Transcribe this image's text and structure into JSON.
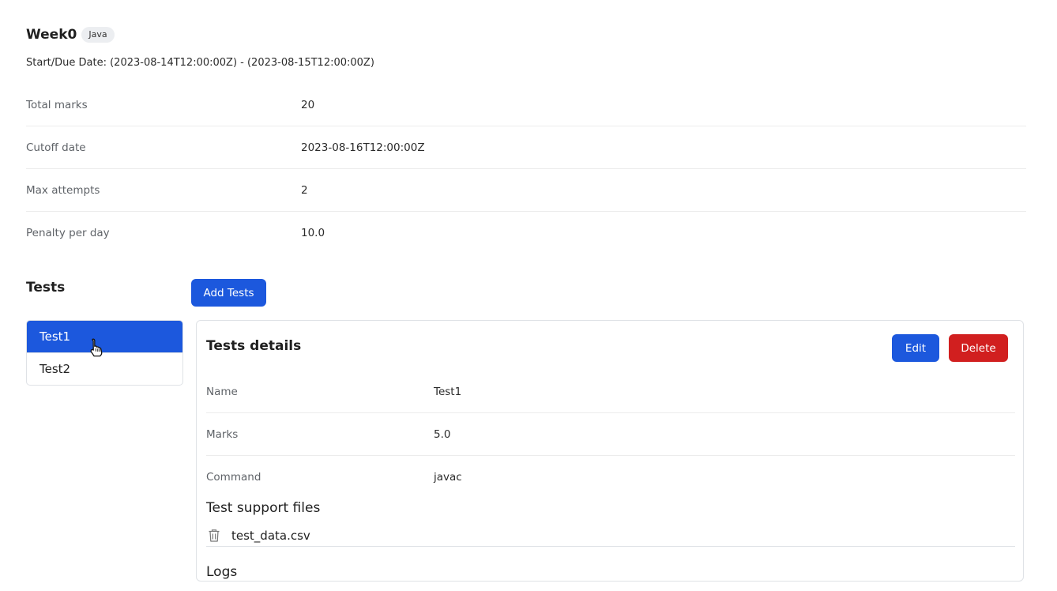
{
  "assignment": {
    "title": "Week0",
    "language": "Java",
    "dates": "Start/Due Date: (2023-08-14T12:00:00Z) - (2023-08-15T12:00:00Z)",
    "fields": [
      {
        "label": "Total marks",
        "value": "20"
      },
      {
        "label": "Cutoff date",
        "value": "2023-08-16T12:00:00Z"
      },
      {
        "label": "Max attempts",
        "value": "2"
      },
      {
        "label": "Penalty per day",
        "value": "10.0"
      }
    ]
  },
  "tests": {
    "heading": "Tests",
    "add_label": "Add Tests",
    "items": [
      {
        "label": "Test1",
        "selected": true
      },
      {
        "label": "Test2",
        "selected": false
      }
    ]
  },
  "details": {
    "title": "Tests details",
    "edit_label": "Edit",
    "delete_label": "Delete",
    "fields": [
      {
        "label": "Name",
        "value": "Test1"
      },
      {
        "label": "Marks",
        "value": "5.0"
      },
      {
        "label": "Command",
        "value": "javac"
      }
    ],
    "support_title": "Test support files",
    "files": [
      {
        "name": "test_data.csv",
        "icon": "trash-icon"
      }
    ],
    "logs_title": "Logs"
  },
  "colors": {
    "primary": "#1c58dd",
    "danger": "#d11f1f",
    "badge_bg": "#eceef1"
  },
  "cursor": "hand-pointer-icon"
}
